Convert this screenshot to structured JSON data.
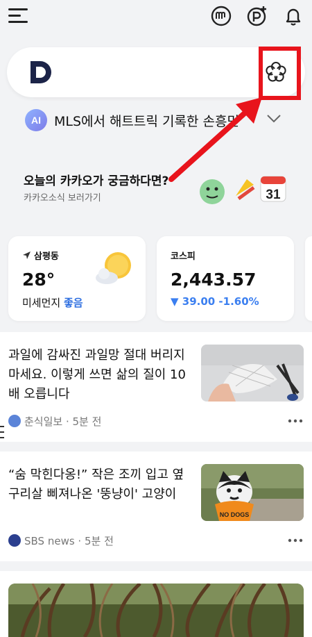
{
  "topbar": {
    "menu_icon": "hamburger-icon",
    "icons": [
      "kakao-m-icon",
      "pay-p-icon",
      "bell-icon"
    ]
  },
  "search": {
    "logo": "D",
    "flower_icon": "flower-icon"
  },
  "ai_summary": {
    "badge": "AI",
    "text": "MLS에서 해트트릭 기록한 손흥민"
  },
  "kakao_news": {
    "title": "오늘의 카카오가 궁금하다면?",
    "subtitle": "카카오소식 보러가기",
    "calendar_day": "31"
  },
  "weather": {
    "location": "삼평동",
    "temperature": "28°",
    "dust_label": "미세먼지",
    "dust_value": "좋음",
    "icon": "sun-cloud-icon"
  },
  "stock": {
    "name": "코스피",
    "value": "2,443.57",
    "change": "▼ 39.00  -1.60%"
  },
  "articles": [
    {
      "title": "과일에 감싸진 과일망 절대 버리지 마세요. 이렇게 쓰면 삶의 질이 10배 오릅니다",
      "source": "춘식일보",
      "time": "5분 전"
    },
    {
      "title": "“숨 막힌다옹!” 작은 조끼 입고 옆구리살 삐져나온 '뚱냥이' 고양이",
      "source": "SBS news",
      "time": "5분 전",
      "thumb_text": "NO DOGS"
    }
  ],
  "colors": {
    "highlight": "#e8141c",
    "dust_good": "#2f6fe0",
    "stock_down": "#3b7ff0"
  }
}
